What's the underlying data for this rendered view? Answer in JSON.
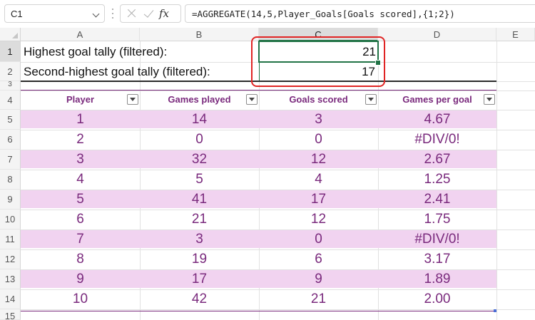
{
  "formula_bar": {
    "name_box": "C1",
    "fx_label": "fx",
    "formula": "=AGGREGATE(14,5,Player_Goals[Goals scored],{1;2})"
  },
  "grid": {
    "columns": [
      "A",
      "B",
      "C",
      "D",
      "E"
    ],
    "rows": [
      "1",
      "2",
      "3",
      "4",
      "5",
      "6",
      "7",
      "8",
      "9",
      "10",
      "11",
      "12",
      "13",
      "14",
      "15"
    ]
  },
  "summary": {
    "row1_label": "Highest goal tally (filtered):",
    "row1_value": "21",
    "row2_label": "Second-highest goal tally (filtered):",
    "row2_value": "17"
  },
  "table": {
    "headers": [
      "Player",
      "Games played",
      "Goals scored",
      "Games per goal"
    ],
    "rows": [
      [
        "1",
        "14",
        "3",
        "4.67"
      ],
      [
        "2",
        "0",
        "0",
        "#DIV/0!"
      ],
      [
        "3",
        "32",
        "12",
        "2.67"
      ],
      [
        "4",
        "5",
        "4",
        "1.25"
      ],
      [
        "5",
        "41",
        "17",
        "2.41"
      ],
      [
        "6",
        "21",
        "12",
        "1.75"
      ],
      [
        "7",
        "3",
        "0",
        "#DIV/0!"
      ],
      [
        "8",
        "19",
        "6",
        "3.17"
      ],
      [
        "9",
        "17",
        "9",
        "1.89"
      ],
      [
        "10",
        "42",
        "21",
        "2.00"
      ]
    ]
  },
  "colors": {
    "band": "#f1d3f0",
    "table_text": "#7a2a7d",
    "selection": "#217346",
    "highlight": "#e02424"
  },
  "icons": [
    "chevron-down-icon",
    "cancel-icon",
    "enter-icon",
    "function-icon",
    "filter-dropdown-icon"
  ]
}
